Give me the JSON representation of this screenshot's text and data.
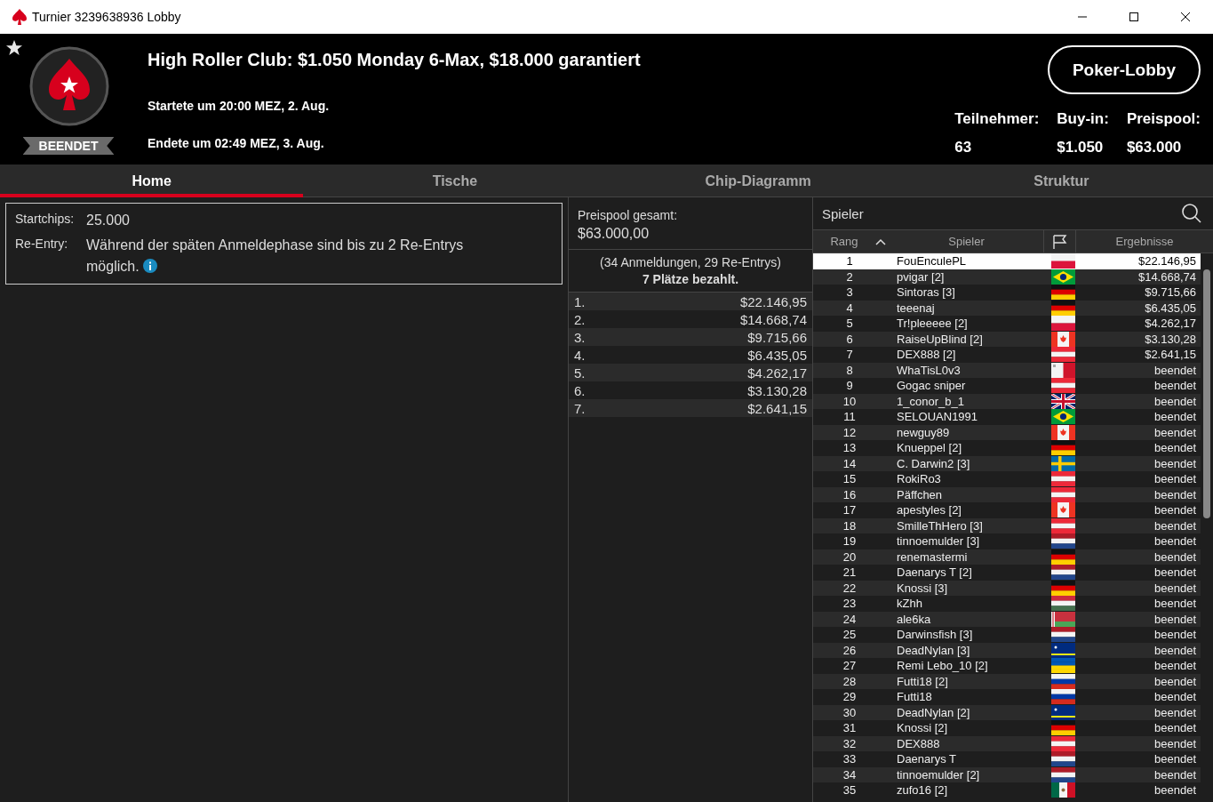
{
  "window": {
    "title": "Turnier 3239638936 Lobby"
  },
  "header": {
    "favorite": true,
    "status": "BEENDET",
    "title": "High Roller Club: $1.050 Monday 6-Max, $18.000 garantiert",
    "started": "Startete um 20:00 MEZ, 2. Aug.",
    "ended": "Endete um 02:49 MEZ, 3. Aug.",
    "lobby_button": "Poker-Lobby",
    "stats": [
      {
        "label": "Teilnehmer:",
        "value": "63"
      },
      {
        "label": "Buy-in:",
        "value": "$1.050"
      },
      {
        "label": "Preispool:",
        "value": "$63.000"
      }
    ]
  },
  "tabs": [
    {
      "label": "Home",
      "selected": true
    },
    {
      "label": "Tische",
      "selected": false
    },
    {
      "label": "Chip-Diagramm",
      "selected": false
    },
    {
      "label": "Struktur",
      "selected": false
    }
  ],
  "info": {
    "rows": [
      {
        "label": "Startchips:",
        "value": "25.000",
        "info_icon": false
      },
      {
        "label": "Re-Entry:",
        "value": "Während der späten Anmeldephase sind bis zu 2 Re-Entrys möglich.",
        "info_icon": true
      }
    ]
  },
  "prizepool": {
    "label": "Preispool gesamt:",
    "total": "$63.000,00",
    "entries": "(34 Anmeldungen, 29 Re-Entrys)",
    "paid": "7 Plätze bezahlt.",
    "places": [
      {
        "place": "1.",
        "amount": "$22.146,95"
      },
      {
        "place": "2.",
        "amount": "$14.668,74"
      },
      {
        "place": "3.",
        "amount": "$9.715,66"
      },
      {
        "place": "4.",
        "amount": "$6.435,05"
      },
      {
        "place": "5.",
        "amount": "$4.262,17"
      },
      {
        "place": "6.",
        "amount": "$3.130,28"
      },
      {
        "place": "7.",
        "amount": "$2.641,15"
      }
    ]
  },
  "players": {
    "search_label": "Spieler",
    "columns": [
      "Rang",
      "Spieler",
      "Ergebnisse"
    ],
    "rows": [
      {
        "rank": "1",
        "name": "FouEnculePL",
        "flag": {
          "kind": "pl"
        },
        "result": "$22.146,95",
        "selected": true
      },
      {
        "rank": "2",
        "name": "pvigar [2]",
        "flag": {
          "kind": "br"
        },
        "result": "$14.668,74",
        "selected": false
      },
      {
        "rank": "3",
        "name": "Sintoras [3]",
        "flag": {
          "kind": "de"
        },
        "result": "$9.715,66",
        "selected": false
      },
      {
        "rank": "4",
        "name": "teeenaj",
        "flag": {
          "kind": "de"
        },
        "result": "$6.435,05",
        "selected": false
      },
      {
        "rank": "5",
        "name": "Tr!pleeeee [2]",
        "flag": {
          "kind": "pl"
        },
        "result": "$4.262,17",
        "selected": false
      },
      {
        "rank": "6",
        "name": "RaiseUpBlind [2]",
        "flag": {
          "kind": "ca"
        },
        "result": "$3.130,28",
        "selected": false
      },
      {
        "rank": "7",
        "name": "DEX888 [2]",
        "flag": {
          "kind": "at"
        },
        "result": "$2.641,15",
        "selected": false
      },
      {
        "rank": "8",
        "name": "WhaTisL0v3",
        "flag": {
          "kind": "mt"
        },
        "result": "beendet",
        "selected": false
      },
      {
        "rank": "9",
        "name": "Gogac sniper",
        "flag": {
          "kind": "at"
        },
        "result": "beendet",
        "selected": false
      },
      {
        "rank": "10",
        "name": "1_conor_b_1",
        "flag": {
          "kind": "gb"
        },
        "result": "beendet",
        "selected": false
      },
      {
        "rank": "11",
        "name": "SELOUAN1991",
        "flag": {
          "kind": "br"
        },
        "result": "beendet",
        "selected": false
      },
      {
        "rank": "12",
        "name": "newguy89",
        "flag": {
          "kind": "ca"
        },
        "result": "beendet",
        "selected": false
      },
      {
        "rank": "13",
        "name": "Knueppel [2]",
        "flag": {
          "kind": "de"
        },
        "result": "beendet",
        "selected": false
      },
      {
        "rank": "14",
        "name": "C. Darwin2 [3]",
        "flag": {
          "kind": "se"
        },
        "result": "beendet",
        "selected": false
      },
      {
        "rank": "15",
        "name": "RokiRo3",
        "flag": {
          "kind": "at"
        },
        "result": "beendet",
        "selected": false
      },
      {
        "rank": "16",
        "name": "Päffchen",
        "flag": {
          "kind": "at"
        },
        "result": "beendet",
        "selected": false
      },
      {
        "rank": "17",
        "name": "apestyles [2]",
        "flag": {
          "kind": "ca"
        },
        "result": "beendet",
        "selected": false
      },
      {
        "rank": "18",
        "name": "SmilleThHero [3]",
        "flag": {
          "kind": "at"
        },
        "result": "beendet",
        "selected": false
      },
      {
        "rank": "19",
        "name": "tinnoemulder [3]",
        "flag": {
          "kind": "nl"
        },
        "result": "beendet",
        "selected": false
      },
      {
        "rank": "20",
        "name": "renemastermi",
        "flag": {
          "kind": "de"
        },
        "result": "beendet",
        "selected": false
      },
      {
        "rank": "21",
        "name": "Daenarys T [2]",
        "flag": {
          "kind": "nl"
        },
        "result": "beendet",
        "selected": false
      },
      {
        "rank": "22",
        "name": "Knossi [3]",
        "flag": {
          "kind": "de"
        },
        "result": "beendet",
        "selected": false
      },
      {
        "rank": "23",
        "name": "kZhh",
        "flag": {
          "kind": "hu"
        },
        "result": "beendet",
        "selected": false
      },
      {
        "rank": "24",
        "name": "ale6ka",
        "flag": {
          "kind": "by"
        },
        "result": "beendet",
        "selected": false
      },
      {
        "rank": "25",
        "name": "Darwinsfish [3]",
        "flag": {
          "kind": "nl"
        },
        "result": "beendet",
        "selected": false
      },
      {
        "rank": "26",
        "name": "DeadNylan [3]",
        "flag": {
          "kind": "cw"
        },
        "result": "beendet",
        "selected": false
      },
      {
        "rank": "27",
        "name": "Remi Lebo_10 [2]",
        "flag": {
          "kind": "ua"
        },
        "result": "beendet",
        "selected": false
      },
      {
        "rank": "28",
        "name": "Futti18 [2]",
        "flag": {
          "kind": "ru"
        },
        "result": "beendet",
        "selected": false
      },
      {
        "rank": "29",
        "name": "Futti18",
        "flag": {
          "kind": "ru"
        },
        "result": "beendet",
        "selected": false
      },
      {
        "rank": "30",
        "name": "DeadNylan [2]",
        "flag": {
          "kind": "cw"
        },
        "result": "beendet",
        "selected": false
      },
      {
        "rank": "31",
        "name": "Knossi [2]",
        "flag": {
          "kind": "de"
        },
        "result": "beendet",
        "selected": false
      },
      {
        "rank": "32",
        "name": "DEX888",
        "flag": {
          "kind": "at"
        },
        "result": "beendet",
        "selected": false
      },
      {
        "rank": "33",
        "name": "Daenarys T",
        "flag": {
          "kind": "nl"
        },
        "result": "beendet",
        "selected": false
      },
      {
        "rank": "34",
        "name": "tinnoemulder [2]",
        "flag": {
          "kind": "nl"
        },
        "result": "beendet",
        "selected": false
      },
      {
        "rank": "35",
        "name": "zufo16 [2]",
        "flag": {
          "kind": "mx"
        },
        "result": "beendet",
        "selected": false
      }
    ]
  }
}
